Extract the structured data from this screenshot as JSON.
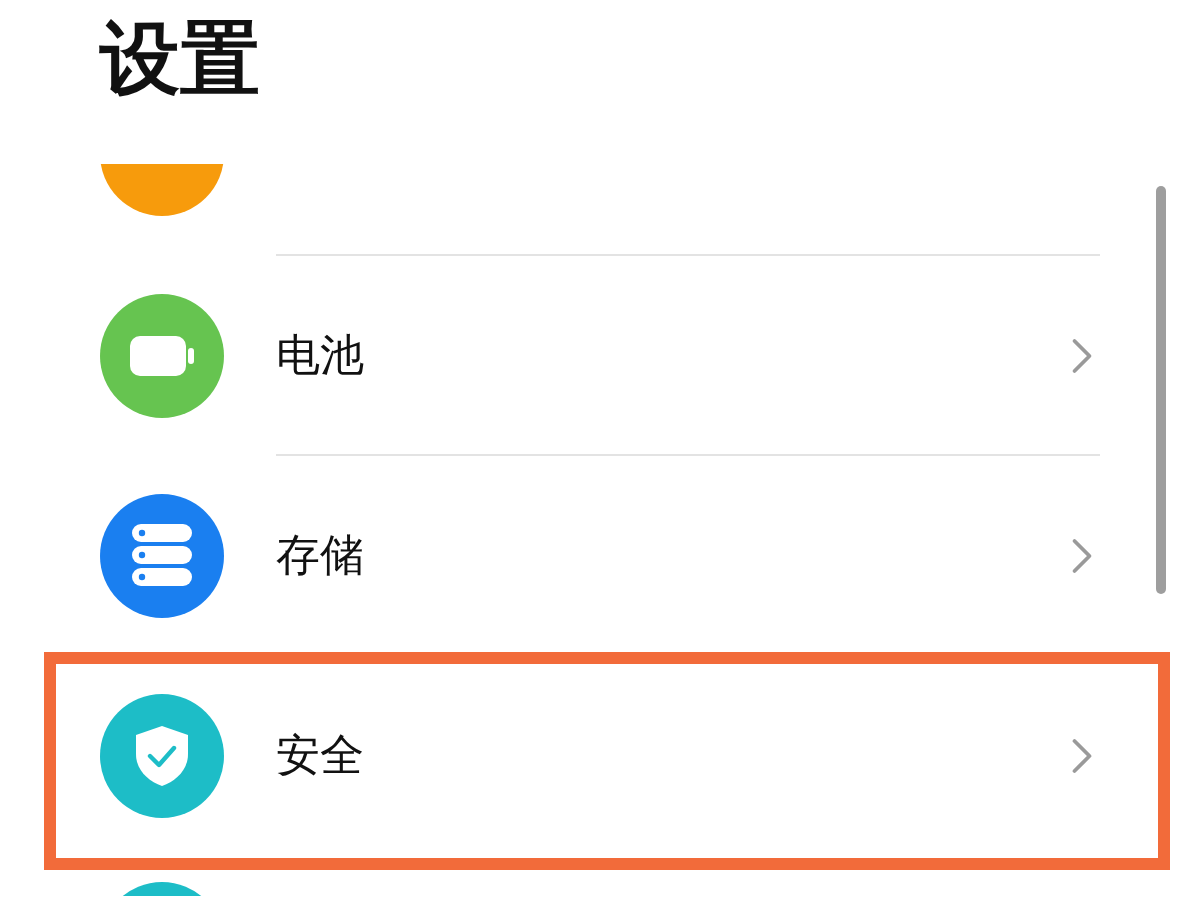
{
  "title": "设置",
  "items": [
    {
      "kind": "cut_top",
      "color": "#f79b0c",
      "highlighted": false
    },
    {
      "kind": "battery",
      "label": "电池",
      "color": "#66c450",
      "highlighted": false
    },
    {
      "kind": "storage",
      "label": "存储",
      "color": "#1a7ff0",
      "highlighted": false
    },
    {
      "kind": "security",
      "label": "安全",
      "color": "#1dbdc7",
      "highlighted": true
    },
    {
      "kind": "cut_bottom",
      "color": "#1dbdc7",
      "highlighted": false
    }
  ]
}
